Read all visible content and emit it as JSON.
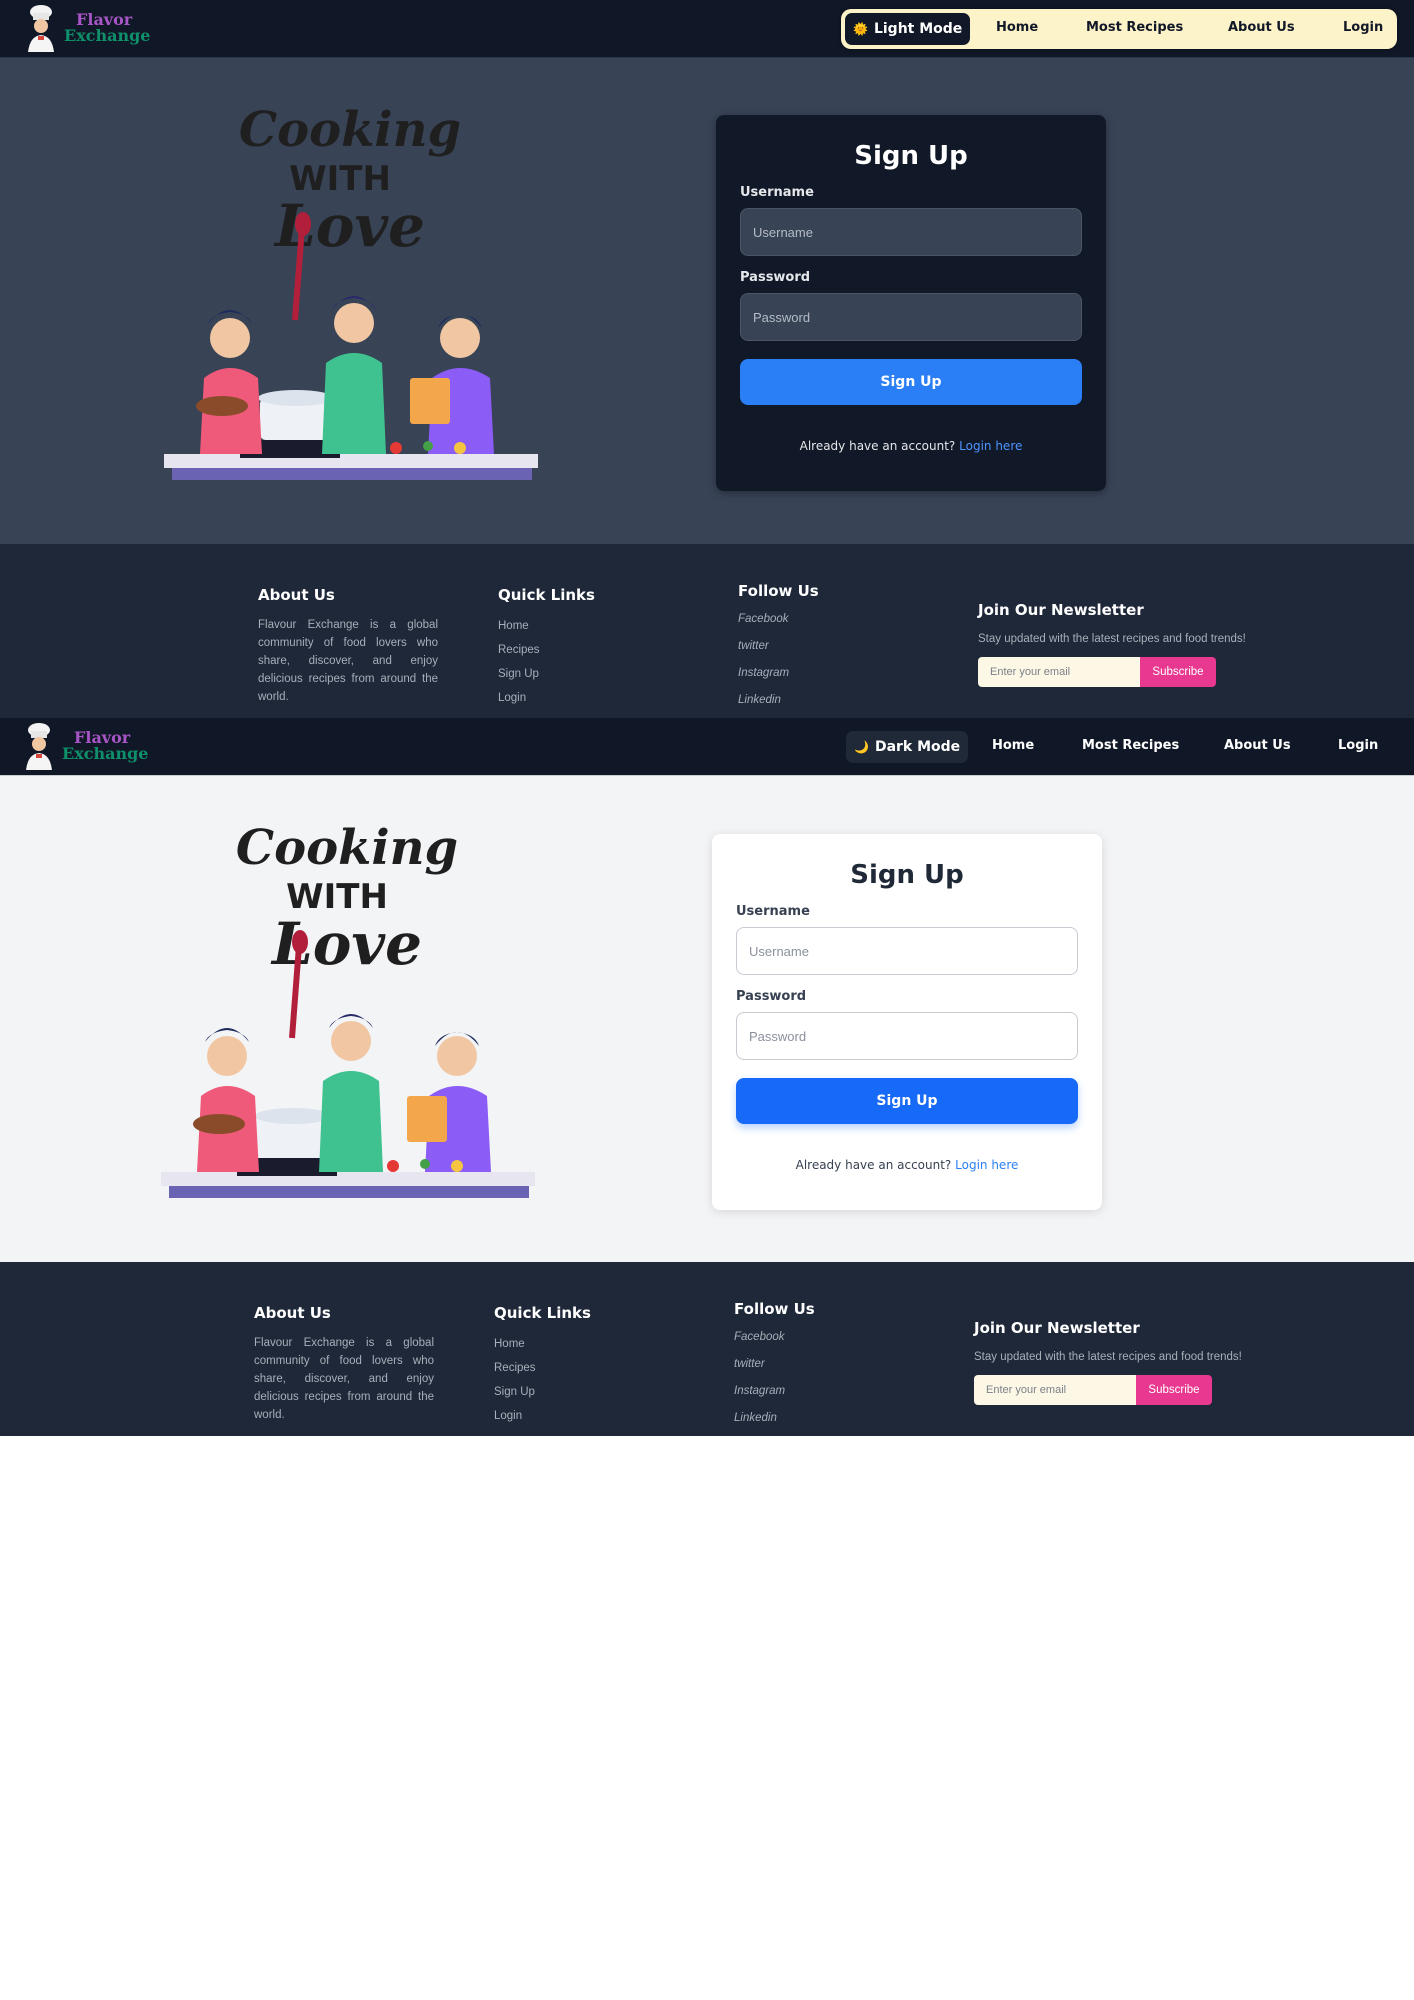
{
  "brand": {
    "line1": "Flavor",
    "line2": "Exchange"
  },
  "views": [
    {
      "theme": "dark",
      "nav": {
        "mode_label": "Light Mode",
        "mode_icon": "sun-icon",
        "links": [
          "Home",
          "Most Recipes",
          "About Us",
          "Login"
        ]
      },
      "signup": {
        "title": "Sign Up",
        "username_label": "Username",
        "username_placeholder": "Username",
        "password_label": "Password",
        "password_placeholder": "Password",
        "submit_label": "Sign Up",
        "switch_text": "Already have an account?",
        "switch_link": "Login here"
      },
      "illustration": {
        "line1": "Cooking",
        "line2": "WITH",
        "line3": "Love"
      }
    },
    {
      "theme": "light",
      "nav": {
        "mode_label": "Dark Mode",
        "mode_icon": "moon-icon",
        "links": [
          "Home",
          "Most Recipes",
          "About Us",
          "Login"
        ]
      },
      "signup": {
        "title": "Sign Up",
        "username_label": "Username",
        "username_placeholder": "Username",
        "password_label": "Password",
        "password_placeholder": "Password",
        "submit_label": "Sign Up",
        "switch_text": "Already have an account?",
        "switch_link": "Login here"
      },
      "illustration": {
        "line1": "Cooking",
        "line2": "WITH",
        "line3": "Love"
      }
    }
  ],
  "footer": {
    "about_title": "About Us",
    "about_text": "Flavour Exchange is a global community of food lovers who share, discover, and enjoy delicious recipes from around the world.",
    "links_title": "Quick Links",
    "links": [
      "Home",
      "Recipes",
      "Sign Up",
      "Login"
    ],
    "follow_title": "Follow Us",
    "social": [
      "Facebook",
      "twitter",
      "Instagram",
      "Linkedin"
    ],
    "newsletter_title": "Join Our Newsletter",
    "newsletter_text": "Stay updated with the latest recipes and food trends!",
    "email_placeholder": "Enter your email",
    "subscribe_label": "Subscribe"
  },
  "colors": {
    "dark_nav_bg": "#101726",
    "dark_hero_bg": "#384356",
    "light_hero_bg": "#f3f4f6",
    "footer_bg": "#1f2839",
    "primary_button": "#2b7ff6",
    "subscribe_button": "#e8388f",
    "brand_purple": "#a855c7",
    "brand_green": "#0f8f6a"
  }
}
